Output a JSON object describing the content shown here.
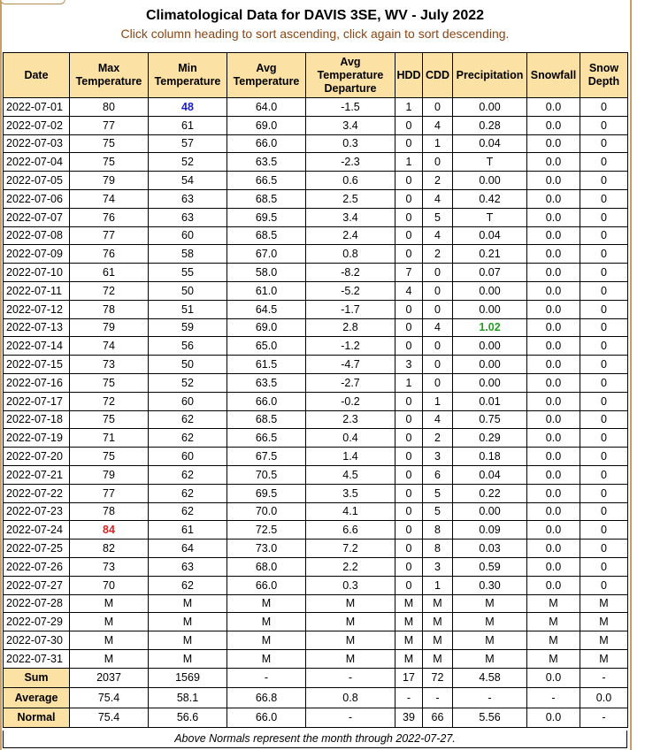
{
  "page": {
    "title": "Climatological Data for DAVIS 3SE, WV - July 2022",
    "subtitle": "Click column heading to sort ascending, click again to sort descending.",
    "footnote": "Above Normals represent the month through 2022-07-27."
  },
  "colors": {
    "header_bg": "#fbe1a4",
    "subtitle": "#8b4513",
    "min_temp_highlight": "#1a1ad6",
    "max_temp_highlight": "#e02020",
    "precip_highlight": "#22a022",
    "frame": "#c8a064"
  },
  "table": {
    "headers": [
      {
        "key": "date",
        "label": "Date"
      },
      {
        "key": "max_temp",
        "label": "Max Temperature"
      },
      {
        "key": "min_temp",
        "label": "Min Temperature"
      },
      {
        "key": "avg_temp",
        "label": "Avg Temperature"
      },
      {
        "key": "departure",
        "label": "Avg Temperature Departure"
      },
      {
        "key": "hdd",
        "label": "HDD"
      },
      {
        "key": "cdd",
        "label": "CDD"
      },
      {
        "key": "precip",
        "label": "Precipitation"
      },
      {
        "key": "snowfall",
        "label": "Snowfall"
      },
      {
        "key": "snow_depth",
        "label": "Snow Depth"
      }
    ],
    "rows": [
      [
        "2022-07-01",
        "80",
        "48",
        "64.0",
        "-1.5",
        "1",
        "0",
        "0.00",
        "0.0",
        "0"
      ],
      [
        "2022-07-02",
        "77",
        "61",
        "69.0",
        "3.4",
        "0",
        "4",
        "0.28",
        "0.0",
        "0"
      ],
      [
        "2022-07-03",
        "75",
        "57",
        "66.0",
        "0.3",
        "0",
        "1",
        "0.04",
        "0.0",
        "0"
      ],
      [
        "2022-07-04",
        "75",
        "52",
        "63.5",
        "-2.3",
        "1",
        "0",
        "T",
        "0.0",
        "0"
      ],
      [
        "2022-07-05",
        "79",
        "54",
        "66.5",
        "0.6",
        "0",
        "2",
        "0.00",
        "0.0",
        "0"
      ],
      [
        "2022-07-06",
        "74",
        "63",
        "68.5",
        "2.5",
        "0",
        "4",
        "0.42",
        "0.0",
        "0"
      ],
      [
        "2022-07-07",
        "76",
        "63",
        "69.5",
        "3.4",
        "0",
        "5",
        "T",
        "0.0",
        "0"
      ],
      [
        "2022-07-08",
        "77",
        "60",
        "68.5",
        "2.4",
        "0",
        "4",
        "0.04",
        "0.0",
        "0"
      ],
      [
        "2022-07-09",
        "76",
        "58",
        "67.0",
        "0.8",
        "0",
        "2",
        "0.21",
        "0.0",
        "0"
      ],
      [
        "2022-07-10",
        "61",
        "55",
        "58.0",
        "-8.2",
        "7",
        "0",
        "0.07",
        "0.0",
        "0"
      ],
      [
        "2022-07-11",
        "72",
        "50",
        "61.0",
        "-5.2",
        "4",
        "0",
        "0.00",
        "0.0",
        "0"
      ],
      [
        "2022-07-12",
        "78",
        "51",
        "64.5",
        "-1.7",
        "0",
        "0",
        "0.00",
        "0.0",
        "0"
      ],
      [
        "2022-07-13",
        "79",
        "59",
        "69.0",
        "2.8",
        "0",
        "4",
        "1.02",
        "0.0",
        "0"
      ],
      [
        "2022-07-14",
        "74",
        "56",
        "65.0",
        "-1.2",
        "0",
        "0",
        "0.00",
        "0.0",
        "0"
      ],
      [
        "2022-07-15",
        "73",
        "50",
        "61.5",
        "-4.7",
        "3",
        "0",
        "0.00",
        "0.0",
        "0"
      ],
      [
        "2022-07-16",
        "75",
        "52",
        "63.5",
        "-2.7",
        "1",
        "0",
        "0.00",
        "0.0",
        "0"
      ],
      [
        "2022-07-17",
        "72",
        "60",
        "66.0",
        "-0.2",
        "0",
        "1",
        "0.01",
        "0.0",
        "0"
      ],
      [
        "2022-07-18",
        "75",
        "62",
        "68.5",
        "2.3",
        "0",
        "4",
        "0.75",
        "0.0",
        "0"
      ],
      [
        "2022-07-19",
        "71",
        "62",
        "66.5",
        "0.4",
        "0",
        "2",
        "0.29",
        "0.0",
        "0"
      ],
      [
        "2022-07-20",
        "75",
        "60",
        "67.5",
        "1.4",
        "0",
        "3",
        "0.18",
        "0.0",
        "0"
      ],
      [
        "2022-07-21",
        "79",
        "62",
        "70.5",
        "4.5",
        "0",
        "6",
        "0.04",
        "0.0",
        "0"
      ],
      [
        "2022-07-22",
        "77",
        "62",
        "69.5",
        "3.5",
        "0",
        "5",
        "0.22",
        "0.0",
        "0"
      ],
      [
        "2022-07-23",
        "78",
        "62",
        "70.0",
        "4.1",
        "0",
        "5",
        "0.00",
        "0.0",
        "0"
      ],
      [
        "2022-07-24",
        "84",
        "61",
        "72.5",
        "6.6",
        "0",
        "8",
        "0.09",
        "0.0",
        "0"
      ],
      [
        "2022-07-25",
        "82",
        "64",
        "73.0",
        "7.2",
        "0",
        "8",
        "0.03",
        "0.0",
        "0"
      ],
      [
        "2022-07-26",
        "73",
        "63",
        "68.0",
        "2.2",
        "0",
        "3",
        "0.59",
        "0.0",
        "0"
      ],
      [
        "2022-07-27",
        "70",
        "62",
        "66.0",
        "0.3",
        "0",
        "1",
        "0.30",
        "0.0",
        "0"
      ],
      [
        "2022-07-28",
        "M",
        "M",
        "M",
        "M",
        "M",
        "M",
        "M",
        "M",
        "M"
      ],
      [
        "2022-07-29",
        "M",
        "M",
        "M",
        "M",
        "M",
        "M",
        "M",
        "M",
        "M"
      ],
      [
        "2022-07-30",
        "M",
        "M",
        "M",
        "M",
        "M",
        "M",
        "M",
        "M",
        "M"
      ],
      [
        "2022-07-31",
        "M",
        "M",
        "M",
        "M",
        "M",
        "M",
        "M",
        "M",
        "M"
      ]
    ],
    "highlights": [
      {
        "row": 0,
        "col": 2,
        "style": "low"
      },
      {
        "row": 23,
        "col": 1,
        "style": "high"
      },
      {
        "row": 12,
        "col": 7,
        "style": "precip"
      }
    ],
    "summary": [
      [
        "Sum",
        "2037",
        "1569",
        "-",
        "-",
        "17",
        "72",
        "4.58",
        "0.0",
        "-"
      ],
      [
        "Average",
        "75.4",
        "58.1",
        "66.8",
        "0.8",
        "-",
        "-",
        "-",
        "-",
        "0.0"
      ],
      [
        "Normal",
        "75.4",
        "56.6",
        "66.0",
        "-",
        "39",
        "66",
        "5.56",
        "0.0",
        "-"
      ]
    ]
  }
}
